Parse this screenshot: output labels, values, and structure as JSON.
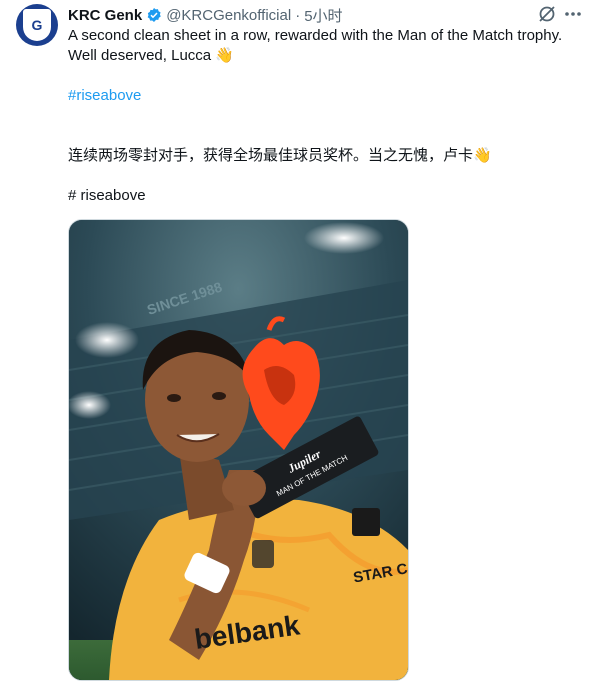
{
  "tweet": {
    "author_name": "KRC Genk",
    "handle": "@KRCGenkofficial",
    "separator": "·",
    "time": "5小时",
    "line1": "A second clean sheet in a row, rewarded with the Man of the Match trophy.",
    "line2": "Well deserved, Lucca 👋",
    "hashtag": "#riseabove",
    "zh_line": "连续两场零封对手，获得全场最佳球员奖杯。当之无愧，卢卡👋",
    "zh_hashtag": "# riseabove",
    "avatar_text": "G"
  },
  "media": {
    "trophy_brand": "Jupiler",
    "trophy_text": "MAN OF THE MATCH",
    "stand_text": "SINCE 1988",
    "sponsor_text": "belbank",
    "sleeve_sponsor": "STAR CASINO"
  },
  "colors": {
    "brand_blue": "#1b3f8f",
    "link": "#1d9bf0",
    "secondary_text": "#536471",
    "jersey": "#f2b33d",
    "trophy_orange": "#ff4a1c"
  },
  "icons": [
    "verified-badge-icon",
    "grok-icon",
    "more-icon"
  ]
}
